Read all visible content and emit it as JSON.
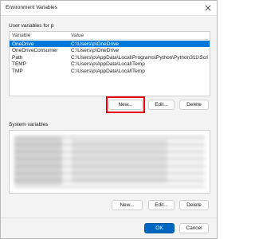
{
  "window": {
    "title": "Environment Variables",
    "close_icon": "close-icon"
  },
  "user_section": {
    "label": "User variables for p",
    "columns": [
      "Variable",
      "Value"
    ],
    "rows": [
      {
        "variable": "OneDrive",
        "value": "C:\\Users\\p\\OneDrive",
        "selected": true
      },
      {
        "variable": "OneDriveConsumer",
        "value": "C:\\Users\\p\\OneDrive",
        "selected": false
      },
      {
        "variable": "Path",
        "value": "C:\\Users\\p\\AppData\\Local\\Programs\\Python\\Python311\\Scrip...",
        "selected": false
      },
      {
        "variable": "TEMP",
        "value": "C:\\Users\\p\\AppData\\Local\\Temp",
        "selected": false
      },
      {
        "variable": "TMP",
        "value": "C:\\Users\\p\\AppData\\Local\\Temp",
        "selected": false
      }
    ],
    "buttons": {
      "new": "New...",
      "edit": "Edit...",
      "delete": "Delete"
    }
  },
  "system_section": {
    "label": "System variables",
    "buttons": {
      "new": "New...",
      "edit": "Edit...",
      "delete": "Delete"
    }
  },
  "footer": {
    "ok": "OK",
    "cancel": "Cancel"
  },
  "colors": {
    "selection": "#0078d7",
    "primary_button": "#0067c0",
    "highlight_box": "#e60012"
  }
}
